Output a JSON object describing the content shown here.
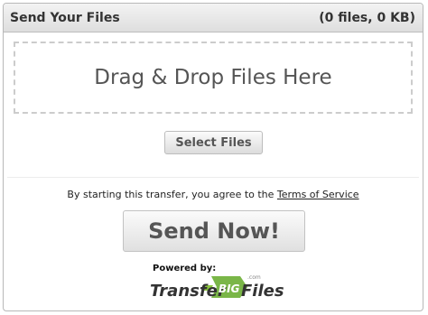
{
  "header": {
    "title": "Send Your Files",
    "file_count": "(0 files, 0 KB)"
  },
  "dropzone": {
    "label": "Drag & Drop Files Here"
  },
  "select_button": {
    "label": "Select Files"
  },
  "terms": {
    "prefix": "By starting this transfer, you agree to the ",
    "link_label": "Terms of Service"
  },
  "send_button": {
    "label": "Send Now!"
  },
  "powered_by": {
    "label": "Powered by:",
    "brand_part1": "Transfer",
    "brand_part2": "BIG",
    "brand_part3": "Files",
    "brand_suffix": ".com"
  },
  "colors": {
    "text": "#555555",
    "logo_green": "#7ab648"
  },
  "icons": [
    "transferbigfiles-logo"
  ]
}
